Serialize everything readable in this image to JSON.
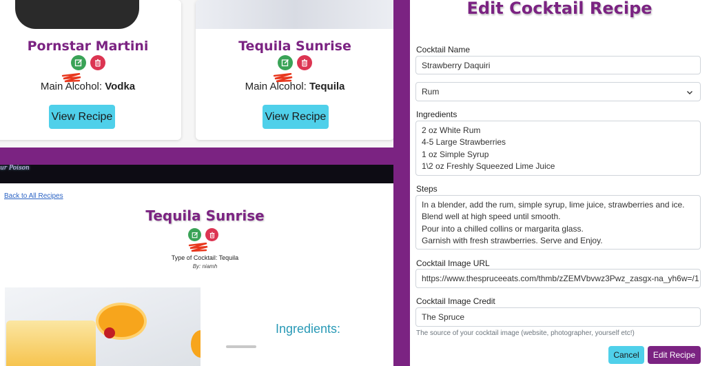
{
  "cards": [
    {
      "title": "Pornstar Martini",
      "alcohol_label": "Main Alcohol:",
      "alcohol_value": "Vodka",
      "view_label": "View Recipe"
    },
    {
      "title": "Tequila Sunrise",
      "alcohol_label": "Main Alcohol:",
      "alcohol_value": "Tequila",
      "view_label": "View Recipe"
    }
  ],
  "detail": {
    "brand": "ur Poison",
    "back_link": "Back to All Recipes",
    "title": "Tequila Sunrise",
    "type_line": "Type of Cocktail: Tequila",
    "by_line": "By: niamh",
    "ingredients_heading": "Ingredients:"
  },
  "form": {
    "heading": "Edit Cocktail Recipe",
    "name_label": "Cocktail Name",
    "name_value": "Strawberry Daquiri",
    "alcohol_select": "Rum",
    "ingredients_label": "Ingredients",
    "ingredients_value": "2 oz White Rum\n4-5 Large Strawberries\n1 oz Simple Syrup\n1\\2 oz Freshly Squeezed Lime Juice",
    "steps_label": "Steps",
    "steps_value": "In a blender, add the rum, simple syrup, lime juice, strawberries and ice.\nBlend well at high speed until smooth.\nPour into a chilled collins or margarita glass.\nGarnish with fresh strawberries. Serve and Enjoy.",
    "image_url_label": "Cocktail Image URL",
    "image_url_value": "https://www.thespruceeats.com/thmb/zZEMVbvwz3Pwz_zasgx-na_yh6w=/1",
    "image_credit_label": "Cocktail Image Credit",
    "image_credit_value": "The Spruce",
    "image_credit_help": "The source of your cocktail image (website, photographer, yourself etc!)",
    "cancel_label": "Cancel",
    "submit_label": "Edit Recipe"
  },
  "icons": {
    "edit": "edit-icon",
    "delete": "trash-icon",
    "select": "chevron-down-icon"
  },
  "colors": {
    "brand_purple": "#7b2382",
    "edit_green": "#3aa357",
    "delete_red": "#dc3552",
    "cyan_button": "#4fd0ea",
    "heading_teal": "#2899b6"
  }
}
